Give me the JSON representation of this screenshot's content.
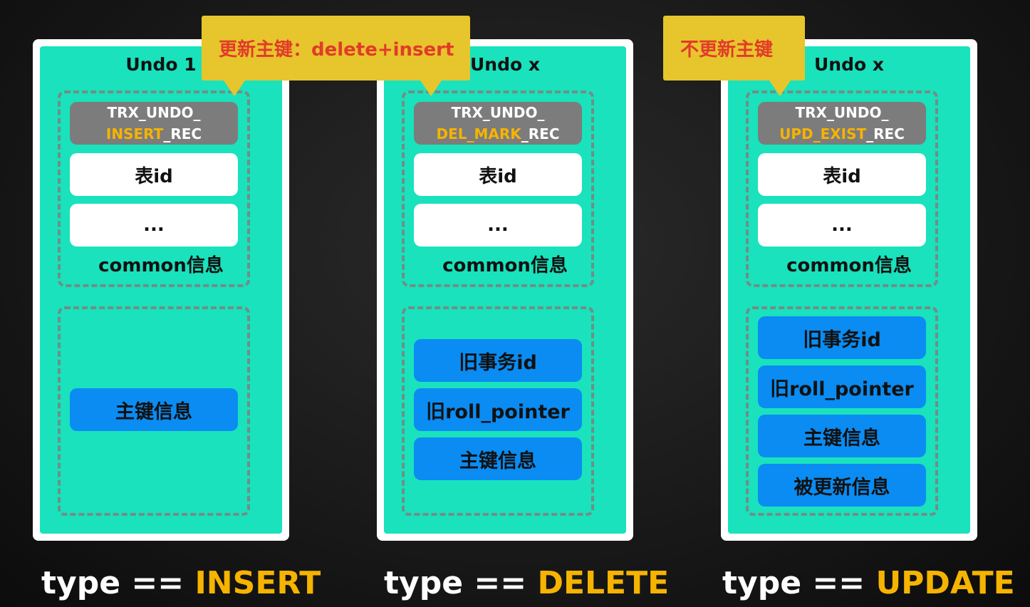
{
  "panels": [
    {
      "title": "Undo 1",
      "record_type_line1": "TRX_UNDO_",
      "record_type_hl": "INSERT",
      "record_type_rest": "_REC",
      "common_items": [
        "表id",
        "..."
      ],
      "common_label": "common信息",
      "bottom_items": [
        "主键信息"
      ],
      "bottom_label_prefix": "type ==",
      "bottom_label_keyword": "INSERT"
    },
    {
      "title": "Undo x",
      "record_type_line1": "TRX_UNDO_",
      "record_type_hl": "DEL_MARK",
      "record_type_rest": "_REC",
      "common_items": [
        "表id",
        "..."
      ],
      "common_label": "common信息",
      "bottom_items": [
        "旧事务id",
        "旧roll_pointer",
        "主键信息"
      ],
      "bottom_label_prefix": "type ==",
      "bottom_label_keyword": "DELETE"
    },
    {
      "title": "Undo x",
      "record_type_line1": "TRX_UNDO_",
      "record_type_hl": "UPD_EXIST",
      "record_type_rest": "_REC",
      "common_items": [
        "表id",
        "..."
      ],
      "common_label": "common信息",
      "bottom_items": [
        "旧事务id",
        "旧roll_pointer",
        "主键信息",
        "被更新信息"
      ],
      "bottom_label_prefix": "type ==",
      "bottom_label_keyword": "UPDATE"
    }
  ],
  "callouts": [
    {
      "text": "更新主键：delete+insert"
    },
    {
      "text": "不更新主键"
    }
  ],
  "colors": {
    "panel_fill": "#19e2bd",
    "record_box": "#7c7c7c",
    "highlight": "#f6b300",
    "blue_box": "#0a8cf2",
    "callout_bg": "#e7c52c",
    "callout_text": "#e23a2a"
  }
}
